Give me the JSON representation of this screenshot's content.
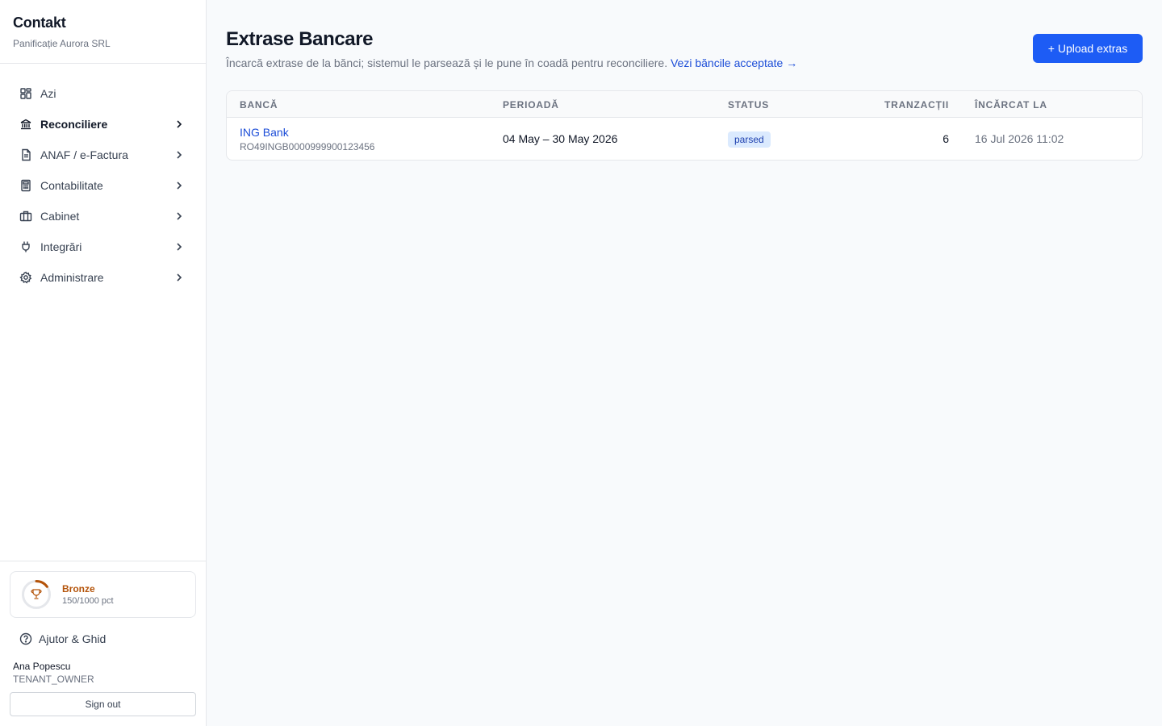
{
  "brand": {
    "title": "Contakt",
    "company": "Panificație Aurora SRL"
  },
  "sidebar": {
    "items": [
      {
        "label": "Azi",
        "icon": "dashboard-icon",
        "active": false,
        "has_children": false
      },
      {
        "label": "Reconciliere",
        "icon": "bank-icon",
        "active": true,
        "has_children": true
      },
      {
        "label": "ANAF / e-Factura",
        "icon": "document-icon",
        "active": false,
        "has_children": true
      },
      {
        "label": "Contabilitate",
        "icon": "calculator-icon",
        "active": false,
        "has_children": true
      },
      {
        "label": "Cabinet",
        "icon": "briefcase-icon",
        "active": false,
        "has_children": true
      },
      {
        "label": "Integrări",
        "icon": "plug-icon",
        "active": false,
        "has_children": true
      },
      {
        "label": "Administrare",
        "icon": "gear-icon",
        "active": false,
        "has_children": true
      }
    ],
    "level": {
      "name": "Bronze",
      "points": "150/1000 pct",
      "progress": 0.15,
      "color": "#b45309"
    },
    "help_label": "Ajutor & Ghid",
    "user": {
      "name": "Ana Popescu",
      "role": "TENANT_OWNER"
    },
    "signout_label": "Sign out"
  },
  "page": {
    "title": "Extrase Bancare",
    "description": "Încarcă extrase de la bănci; sistemul le parsează și le pune în coadă pentru reconciliere.",
    "link_label": "Vezi băncile acceptate →",
    "upload_label": "+ Upload extras"
  },
  "table": {
    "columns": [
      "Bancă",
      "Perioadă",
      "Status",
      "Tranzacții",
      "Încărcat la"
    ],
    "rows": [
      {
        "bank": "ING Bank",
        "iban": "RO49INGB0000999900123456",
        "period": "04 May – 30 May 2026",
        "status": "parsed",
        "transactions": "6",
        "uploaded_at": "16 Jul 2026 11:02"
      }
    ]
  },
  "colors": {
    "primary": "#1d5cf5",
    "link": "#1d4ed8",
    "badge_bg": "#dbeafe",
    "badge_fg": "#1e40af"
  }
}
